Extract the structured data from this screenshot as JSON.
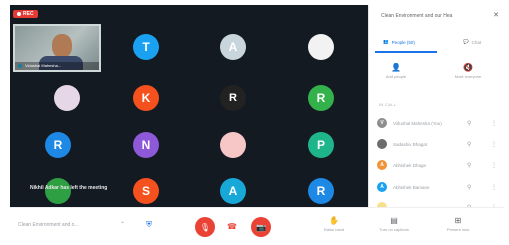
{
  "recording": {
    "label": "REC"
  },
  "self_view": {
    "name": "Vidushal Mahesha..."
  },
  "participant_tiles": [
    {
      "initial": "T",
      "color": "#1ba1f2"
    },
    {
      "initial": "A",
      "color": "#c9d5dd"
    },
    {
      "initial": "",
      "color": "#f2f2f2",
      "kind": "photo-avatar"
    },
    {
      "initial": "",
      "color": "#e6d7e8",
      "kind": "photo-avatar"
    },
    {
      "initial": "K",
      "color": "#f4511e"
    },
    {
      "initial": "R",
      "color": "#222222",
      "kind": "photo-avatar"
    },
    {
      "initial": "R",
      "color": "#33b24b"
    },
    {
      "initial": "R",
      "color": "#1e88e5"
    },
    {
      "initial": "N",
      "color": "#8e59d8"
    },
    {
      "initial": "",
      "color": "#f7c7c7",
      "kind": "photo-avatar"
    },
    {
      "initial": "P",
      "color": "#1fb58b"
    },
    {
      "initial": "",
      "color": "#2ea043"
    },
    {
      "initial": "S",
      "color": "#f4511e"
    },
    {
      "initial": "A",
      "color": "#17a8d8"
    },
    {
      "initial": "R",
      "color": "#1e88e5"
    }
  ],
  "notice": {
    "text": "Nikhil Adkar has left the meeting"
  },
  "panel": {
    "title": "Clean Environment and our Hea",
    "tabs": [
      {
        "label": "People (50)"
      },
      {
        "label": "Chat"
      }
    ],
    "actions": [
      {
        "label": "Add people"
      },
      {
        "label": "Mute everyone"
      }
    ],
    "section_label": "IN CALL",
    "participants": [
      {
        "initial": "V",
        "avatar_color": "#8e8e8e",
        "name": "Vidushal Mahesha (You)"
      },
      {
        "initial": "",
        "avatar_color": "#6d6d6d",
        "name": "Sadashiv Bhagat"
      },
      {
        "initial": "A",
        "avatar_color": "#f09336",
        "name": "Abhishek Dhage"
      },
      {
        "initial": "A",
        "avatar_color": "#1ba1f2",
        "name": "Abhishek Bamane"
      },
      {
        "initial": "",
        "avatar_color": "#f7e08a",
        "name": ""
      }
    ]
  },
  "bottom_bar": {
    "meeting_title": "Clean Environment and o...",
    "actions": [
      {
        "label": "Raise hand"
      },
      {
        "label": "Turn on captions"
      },
      {
        "label": "Present now"
      }
    ]
  },
  "colors": {
    "accent": "#1a73e8",
    "danger": "#ea4335",
    "stage_bg": "#141a22"
  }
}
